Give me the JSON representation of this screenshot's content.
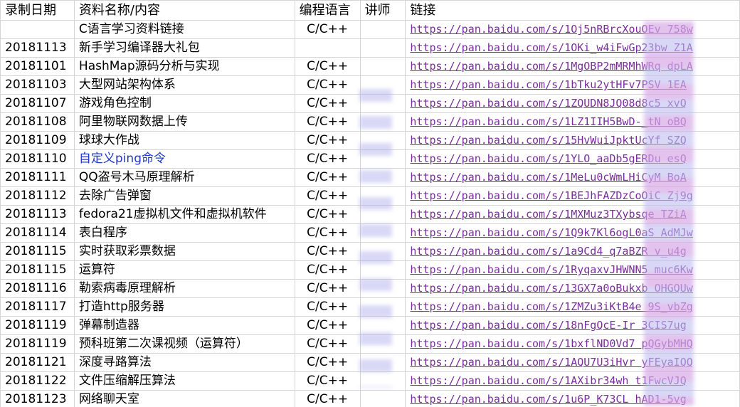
{
  "headers": {
    "date": "录制日期",
    "title": "资料名称/内容",
    "lang": "编程语言",
    "teacher": "讲师",
    "link": "链接"
  },
  "rows": [
    {
      "date": "",
      "title": "C语言学习资料链接",
      "lang": "C/C++",
      "link": "https://pan.baidu.com/s/1Oj5nRBrcXouOEv  758w"
    },
    {
      "date": "20181113",
      "title": "新手学习编译器大礼包",
      "lang": "",
      "link": "https://pan.baidu.com/s/1OKi_w4iFwGp23bw  Z1A"
    },
    {
      "date": "20181101",
      "title": "HashMap源码分析与实现",
      "lang": "C/C++",
      "link": "https://pan.baidu.com/s/1MgOBP2mMRMhWRq  dpLA"
    },
    {
      "date": "20181103",
      "title": "大型网站架构体系",
      "lang": "C/C++",
      "link": "https://pan.baidu.com/s/1bTku2ytHFv7PSV  1EA"
    },
    {
      "date": "20181107",
      "title": "游戏角色控制",
      "lang": "C/C++",
      "link": "https://pan.baidu.com/s/1ZQUDN8JQ08d8c5  xvQ"
    },
    {
      "date": "20181108",
      "title": "阿里物联网数据上传",
      "lang": "C/C++",
      "link": "https://pan.baidu.com/s/1LZ1IIH5BwD-_tN  oBQ"
    },
    {
      "date": "20181109",
      "title": "球球大作战",
      "lang": "C/C++",
      "link": "https://pan.baidu.com/s/15HvWuiJpktUcYf  SZQ"
    },
    {
      "date": "20181110",
      "title": "自定义ping命令",
      "lang": "C/C++",
      "link": "https://pan.baidu.com/s/1YLO_aaDb5gERDu  esQ",
      "blue": true
    },
    {
      "date": "20181111",
      "title": "QQ盗号木马原理解析",
      "lang": "C/C++",
      "link": "https://pan.baidu.com/s/1MeLu0cWmLHiCyM  BoA"
    },
    {
      "date": "20181112",
      "title": "去除广告弹窗",
      "lang": "C/C++",
      "link": "https://pan.baidu.com/s/1BEJhFAZDzCoOiC  Zj9g"
    },
    {
      "date": "20181113",
      "title": "fedora21虚拟机文件和虚拟机软件",
      "lang": "C/C++",
      "link": "https://pan.baidu.com/s/1MXMuz3TXybsqe  TZiA"
    },
    {
      "date": "20181114",
      "title": "表白程序",
      "lang": "C/C++",
      "link": "https://pan.baidu.com/s/1Q9k7Kl6ogL0aS  AdMJw"
    },
    {
      "date": "20181115",
      "title": "实时获取彩票数据",
      "lang": "C/C++",
      "link": "https://pan.baidu.com/s/1a9Cd4_q7aBZR  v_u4g"
    },
    {
      "date": "20181115",
      "title": "运算符",
      "lang": "C/C++",
      "link": "https://pan.baidu.com/s/1RyqaxvJHWNN5  muc6Kw"
    },
    {
      "date": "20181116",
      "title": "勒索病毒原理解析",
      "lang": "C/C++",
      "link": "https://pan.baidu.com/s/13GX7a0oBukxb  OHGQUw"
    },
    {
      "date": "20181117",
      "title": "打造http服务器",
      "lang": "C/C++",
      "link": "https://pan.baidu.com/s/1ZMZu3iKtB4e  9S_vbZg"
    },
    {
      "date": "20181119",
      "title": "弹幕制造器",
      "lang": "C/C++",
      "link": "https://pan.baidu.com/s/18nFgQcE-Ir  3CIS7ug"
    },
    {
      "date": "20181119",
      "title": "预科班第二次课视频（运算符）",
      "lang": "C/C++",
      "link": "https://pan.baidu.com/s/1bxflND0Vd7  pQGybMHQ"
    },
    {
      "date": "20181121",
      "title": "深度寻路算法",
      "lang": "C/C++",
      "link": "https://pan.baidu.com/s/1AQU7U3iHvr  yFEyaIQQ"
    },
    {
      "date": "20181122",
      "title": "文件压缩解压算法",
      "lang": "C/C++",
      "link": "https://pan.baidu.com/s/1AXibr34wh  t1FwcVJQ"
    },
    {
      "date": "20181123",
      "title": "网络聊天室",
      "lang": "C/C++",
      "link": "https://pan.baidu.com/s/1u6P_K73CL  hAD1-5vg"
    }
  ]
}
